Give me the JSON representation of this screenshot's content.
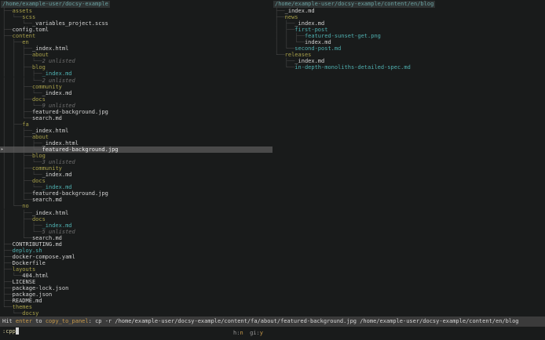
{
  "left_panel": {
    "root": "/home/example-user/docsy-example",
    "input": ":cpp",
    "flags": [
      {
        "label": "h",
        "value": "n"
      },
      {
        "label": "gi",
        "value": "y"
      }
    ],
    "lines": [
      {
        "prefix": "├──",
        "name": "assets",
        "type": "dir"
      },
      {
        "prefix": "│  └──",
        "name": "scss",
        "type": "dir"
      },
      {
        "prefix": "│     └──",
        "name": "_variables_project.scss",
        "type": "file"
      },
      {
        "prefix": "├──",
        "name": "config.toml",
        "type": "file"
      },
      {
        "prefix": "├──",
        "name": "content",
        "type": "dir"
      },
      {
        "prefix": "│  ├──",
        "name": "en",
        "type": "dir"
      },
      {
        "prefix": "│  │  ├──",
        "name": "_index.html",
        "type": "file"
      },
      {
        "prefix": "│  │  ├──",
        "name": "about",
        "type": "dir"
      },
      {
        "prefix": "│  │  │  └──",
        "name": "2 unlisted",
        "type": "unlisted"
      },
      {
        "prefix": "│  │  ├──",
        "name": "blog",
        "type": "dir"
      },
      {
        "prefix": "│  │  │  ├──",
        "name": "_index.md",
        "type": "new"
      },
      {
        "prefix": "│  │  │  └──",
        "name": "2 unlisted",
        "type": "unlisted"
      },
      {
        "prefix": "│  │  ├──",
        "name": "community",
        "type": "dir"
      },
      {
        "prefix": "│  │  │  └──",
        "name": "_index.md",
        "type": "file"
      },
      {
        "prefix": "│  │  ├──",
        "name": "docs",
        "type": "dir"
      },
      {
        "prefix": "│  │  │  └──",
        "name": "9 unlisted",
        "type": "unlisted"
      },
      {
        "prefix": "│  │  ├──",
        "name": "featured-background.jpg",
        "type": "file"
      },
      {
        "prefix": "│  │  └──",
        "name": "search.md",
        "type": "file"
      },
      {
        "prefix": "│  ├──",
        "name": "fa",
        "type": "dir"
      },
      {
        "prefix": "│  │  ├──",
        "name": "_index.html",
        "type": "file"
      },
      {
        "prefix": "│  │  ├──",
        "name": "about",
        "type": "dir"
      },
      {
        "prefix": "│  │  │  ├──",
        "name": "_index.html",
        "type": "file"
      },
      {
        "prefix": "│  │  │  └──",
        "name": "featured-background.jpg",
        "type": "file",
        "selected": true
      },
      {
        "prefix": "│  │  ├──",
        "name": "blog",
        "type": "dir"
      },
      {
        "prefix": "│  │  │  └──",
        "name": "3 unlisted",
        "type": "unlisted"
      },
      {
        "prefix": "│  │  ├──",
        "name": "community",
        "type": "dir"
      },
      {
        "prefix": "│  │  │  └──",
        "name": "_index.md",
        "type": "file"
      },
      {
        "prefix": "│  │  ├──",
        "name": "docs",
        "type": "dir"
      },
      {
        "prefix": "│  │  │  └──",
        "name": "_index.md",
        "type": "new"
      },
      {
        "prefix": "│  │  ├──",
        "name": "featured-background.jpg",
        "type": "file"
      },
      {
        "prefix": "│  │  └──",
        "name": "search.md",
        "type": "file"
      },
      {
        "prefix": "│  └──",
        "name": "no",
        "type": "dir"
      },
      {
        "prefix": "│     ├──",
        "name": "_index.html",
        "type": "file"
      },
      {
        "prefix": "│     ├──",
        "name": "docs",
        "type": "dir"
      },
      {
        "prefix": "│     │  ├──",
        "name": "_index.md",
        "type": "new"
      },
      {
        "prefix": "│     │  └──",
        "name": "5 unlisted",
        "type": "unlisted"
      },
      {
        "prefix": "│     └──",
        "name": "search.md",
        "type": "file"
      },
      {
        "prefix": "├──",
        "name": "CONTRIBUTING.md",
        "type": "file"
      },
      {
        "prefix": "├──",
        "name": "deploy.sh",
        "type": "new"
      },
      {
        "prefix": "├──",
        "name": "docker-compose.yaml",
        "type": "file"
      },
      {
        "prefix": "├──",
        "name": "Dockerfile",
        "type": "file"
      },
      {
        "prefix": "├──",
        "name": "layouts",
        "type": "dir"
      },
      {
        "prefix": "│  └──",
        "name": "404.html",
        "type": "file"
      },
      {
        "prefix": "├──",
        "name": "LICENSE",
        "type": "file"
      },
      {
        "prefix": "├──",
        "name": "package-lock.json",
        "type": "file"
      },
      {
        "prefix": "├──",
        "name": "package.json",
        "type": "file"
      },
      {
        "prefix": "├──",
        "name": "README.md",
        "type": "file"
      },
      {
        "prefix": "└──",
        "name": "themes",
        "type": "dir"
      },
      {
        "prefix": "   └──",
        "name": "docsy",
        "type": "dir"
      }
    ]
  },
  "right_panel": {
    "root": "/home/example-user/docsy-example/content/en/blog",
    "lines": [
      {
        "prefix": "├──",
        "name": "_index.md",
        "type": "file"
      },
      {
        "prefix": "├──",
        "name": "news",
        "type": "dir"
      },
      {
        "prefix": "│  ├──",
        "name": "_index.md",
        "type": "file"
      },
      {
        "prefix": "│  ├──",
        "name": "first-post",
        "type": "new"
      },
      {
        "prefix": "│  │  ├──",
        "name": "featured-sunset-get.png",
        "type": "new"
      },
      {
        "prefix": "│  │  └──",
        "name": "index.md",
        "type": "file"
      },
      {
        "prefix": "│  └──",
        "name": "second-post.md",
        "type": "new"
      },
      {
        "prefix": "└──",
        "name": "releases",
        "type": "dir"
      },
      {
        "prefix": "   ├──",
        "name": "_index.md",
        "type": "file"
      },
      {
        "prefix": "   └──",
        "name": "in-depth-monoliths-detailed-spec.md",
        "type": "new"
      }
    ]
  },
  "status_bar": {
    "hit": "Hit",
    "key": "enter",
    "to": "to",
    "verb": "copy_to_panel",
    "separator": ":",
    "command": "cp -r /home/example-user/docsy-example/content/fa/about/featured-background.jpg /home/example-user/docsy-example/content/en/blog"
  },
  "icons": {
    "selection_marker": "▸"
  },
  "colors": {
    "background": "#191b1b",
    "directory": "#a8a04a",
    "file": "#d2d2d2",
    "git_new": "#4fb0b0",
    "unlisted": "#6e6e6e",
    "root_path": "#6aa2a2",
    "tree_branch": "#474747",
    "selection_background": "#4a4a4a",
    "status_background": "#3b3b3b",
    "keyword": "#c89a4a",
    "input_text": "#d6cf9e"
  }
}
